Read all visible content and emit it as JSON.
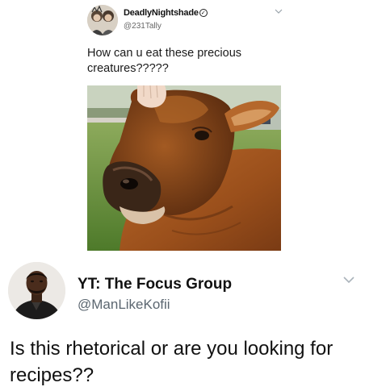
{
  "original_tweet": {
    "display_name": "DeadlyNightshade",
    "verified_glyph": "✓",
    "handle": "@231Tally",
    "text": "How can u eat these precious creatures?????",
    "photo_icon": "cow-photo",
    "menu_icon": "chevron-down-icon"
  },
  "reply_tweet": {
    "display_name": "YT: The Focus Group",
    "handle": "@ManLikeKofii",
    "text": "Is this rhetorical or are you looking for recipes??",
    "menu_icon": "chevron-down-icon"
  },
  "colors": {
    "background": "#ffffff",
    "text": "#111111",
    "handle": "#5b6670",
    "cow_fur": "#a8591f"
  }
}
